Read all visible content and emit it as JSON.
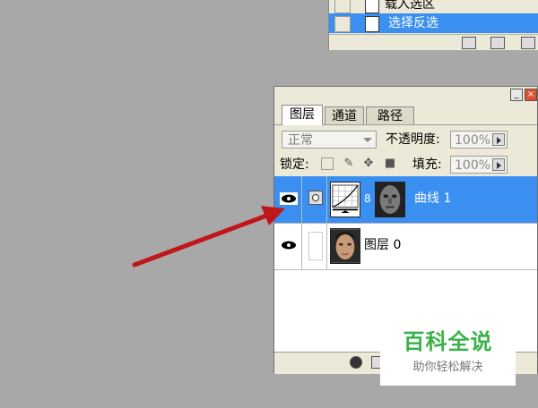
{
  "history_panel": {
    "items": [
      {
        "label": "载入选区",
        "selected": false
      },
      {
        "label": "选择反选",
        "selected": true
      }
    ]
  },
  "layers_panel": {
    "tabs": [
      {
        "label": "图层",
        "active": true
      },
      {
        "label": "通道",
        "active": false
      },
      {
        "label": "路径",
        "active": false
      }
    ],
    "blend_mode": "正常",
    "opacity_label": "不透明度:",
    "opacity_value": "100%",
    "lock_label": "锁定:",
    "fill_label": "填充:",
    "fill_value": "100%",
    "layers": [
      {
        "name": "曲线 1",
        "selected": true,
        "type": "adjustment-curves"
      },
      {
        "name": "图层 0",
        "selected": false,
        "type": "image"
      }
    ]
  },
  "watermark": {
    "title": "百科全说",
    "subtitle": "助你轻松解决"
  },
  "colors": {
    "background": "#a8a8a8",
    "selection": "#3a8ff0",
    "arrow": "#c0161a",
    "watermark_green": "#3ab24a"
  }
}
